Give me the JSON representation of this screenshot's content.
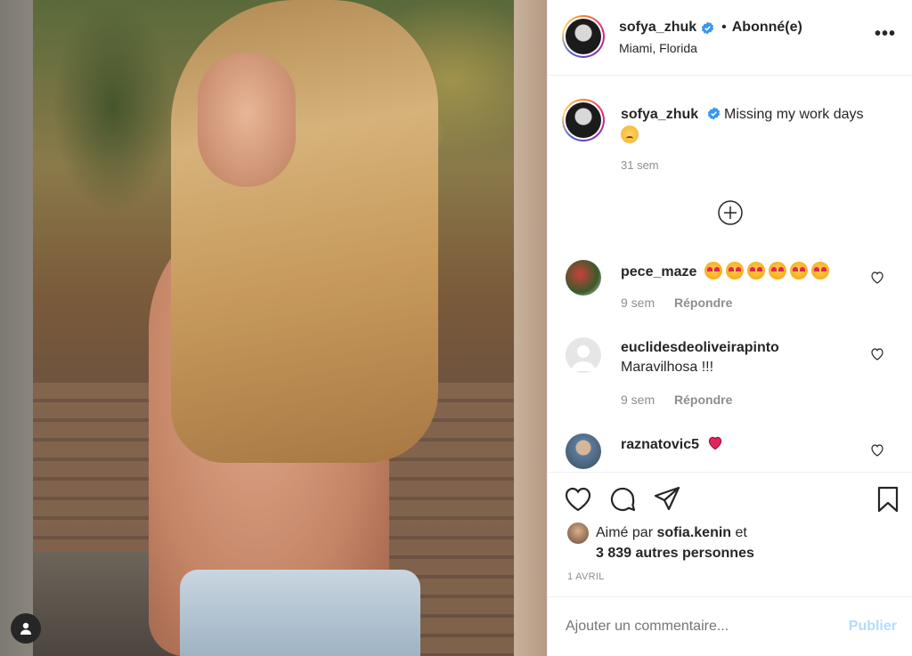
{
  "post": {
    "username": "sofya_zhuk",
    "separator": "•",
    "follow_status": "Abonné(e)",
    "location": "Miami, Florida",
    "more_label": "•••"
  },
  "caption": {
    "username": "sofya_zhuk",
    "text": "Missing my work days",
    "emoji": "pensive-face-emoji",
    "time": "31 sem"
  },
  "comments": [
    {
      "username": "pece_maze",
      "text": "",
      "emojis": [
        "heart-eyes",
        "heart-eyes",
        "heart-eyes",
        "heart-eyes",
        "heart-eyes",
        "heart-eyes"
      ],
      "time": "9 sem",
      "reply_label": "Répondre"
    },
    {
      "username": "euclidesdeoliveirapinto",
      "text": "Maravilhosa !!!",
      "time": "9 sem",
      "reply_label": "Répondre"
    },
    {
      "username": "raznatovic5",
      "text": "",
      "emojis": [
        "red-heart"
      ]
    }
  ],
  "likes": {
    "prefix": "Aimé par",
    "liker": "sofia.kenin",
    "conjunction": "et",
    "others": "3 839 autres personnes"
  },
  "date": "1 AVRIL",
  "add_comment": {
    "placeholder": "Ajouter un commentaire...",
    "post_label": "Publier"
  },
  "colors": {
    "verified": "#3897f0",
    "muted": "#8e8e8e",
    "publish_disabled": "#b3dbff",
    "heart": "#e0245e"
  }
}
